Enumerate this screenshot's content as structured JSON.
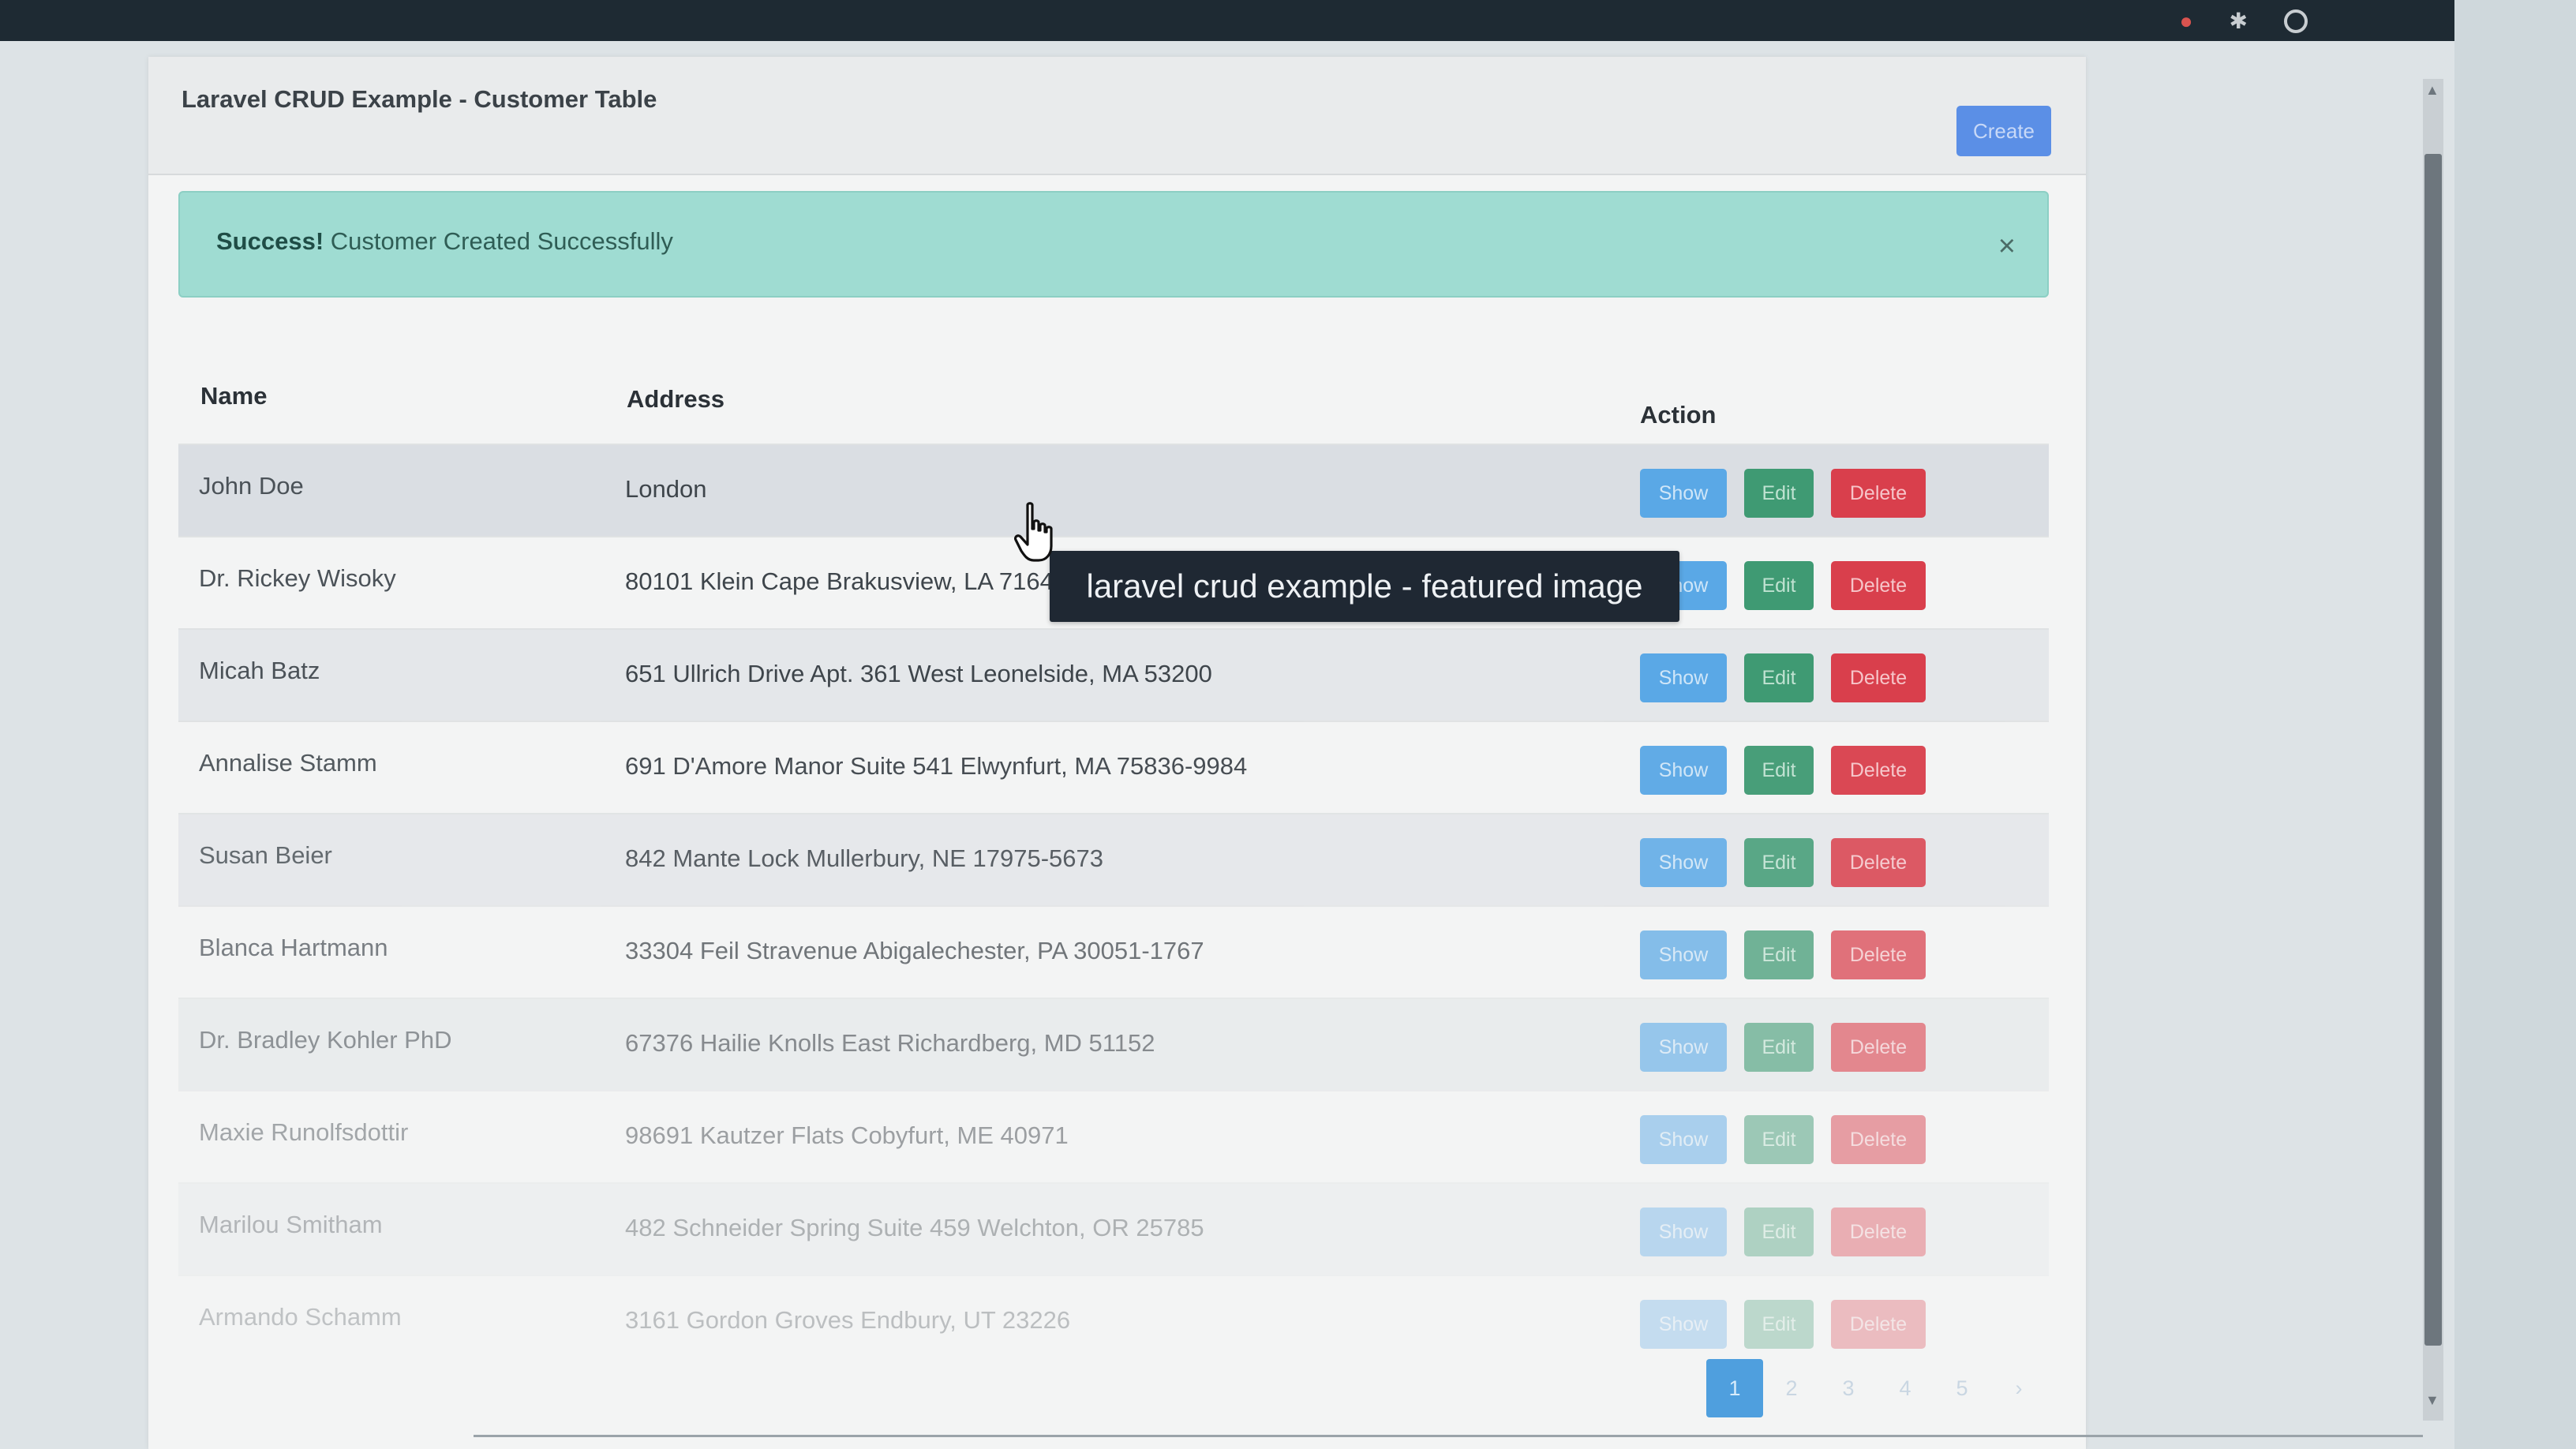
{
  "card": {
    "title": "Laravel CRUD Example - Customer Table",
    "create_label": "Create"
  },
  "alert": {
    "strong": "Success!",
    "message": " Customer Created Successfully",
    "close": "×"
  },
  "table": {
    "headers": {
      "name": "Name",
      "address": "Address",
      "action": "Action"
    },
    "rows": [
      {
        "name": "John Doe",
        "address": "London"
      },
      {
        "name": "Dr. Rickey Wisoky",
        "address": "80101 Klein Cape Brakusview, LA 71645-7892"
      },
      {
        "name": "Micah Batz",
        "address": "651 Ullrich Drive Apt. 361 West Leonelside, MA 53200"
      },
      {
        "name": "Annalise Stamm",
        "address": "691 D'Amore Manor Suite 541 Elwynfurt, MA 75836-9984"
      },
      {
        "name": "Susan Beier",
        "address": "842 Mante Lock Mullerbury, NE 17975-5673"
      },
      {
        "name": "Blanca Hartmann",
        "address": "33304 Feil Stravenue Abigalechester, PA 30051-1767"
      },
      {
        "name": "Dr. Bradley Kohler PhD",
        "address": "67376 Hailie Knolls East Richardberg, MD 51152"
      },
      {
        "name": "Maxie Runolfsdottir",
        "address": "98691 Kautzer Flats Cobyfurt, ME 40971"
      },
      {
        "name": "Marilou Smitham",
        "address": "482 Schneider Spring Suite 459 Welchton, OR 25785"
      },
      {
        "name": "Armando Schamm",
        "address": "3161 Gordon Groves Endbury, UT 23226"
      }
    ],
    "actions": {
      "show": "Show",
      "edit": "Edit",
      "delete": "Delete"
    }
  },
  "pagination": {
    "pages": [
      "1",
      "2",
      "3",
      "4",
      "5",
      "›"
    ],
    "active": "1"
  },
  "tooltip": {
    "text": "laravel crud example - featured image"
  },
  "colors": {
    "primary": "#5b8fe6",
    "info": "#5aa8e6",
    "success": "#3f9a73",
    "danger": "#d93f4c",
    "alert_bg": "#9fdcd2",
    "tooltip_bg": "#1f2833"
  },
  "icons": {
    "close": "close-icon",
    "cursor": "hand-pointer-icon",
    "window_dot": "record-dot-icon",
    "window_pin": "pin-icon",
    "window_circle": "circle-icon"
  }
}
